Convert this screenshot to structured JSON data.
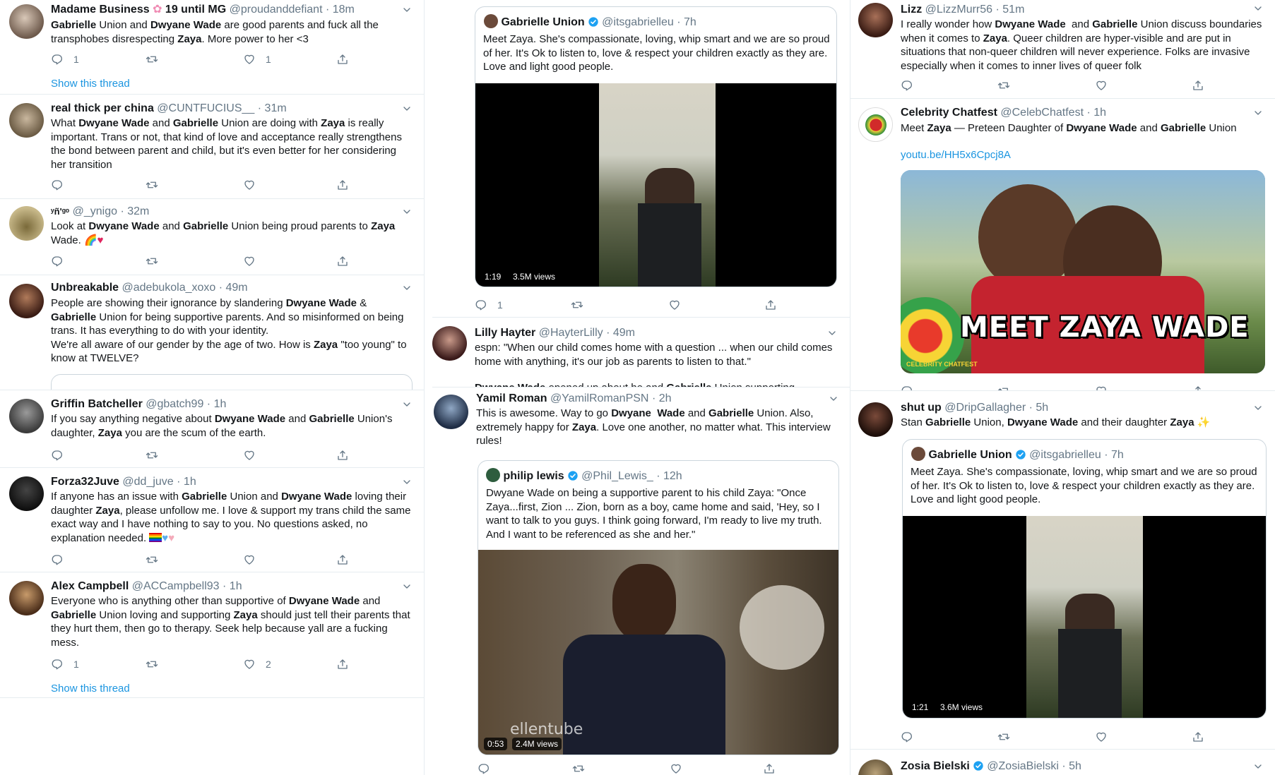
{
  "colors": {
    "accent": "#1b95e0",
    "text": "#14171a",
    "muted": "#657786",
    "divider": "#e6ecf0",
    "heart": "#e0245e"
  },
  "icons": {
    "reply": "reply-icon",
    "retweet": "retweet-icon",
    "like": "heart-icon",
    "share": "share-icon",
    "menu": "chevron-down-icon",
    "verified": "verified-badge-icon"
  },
  "col1": {
    "t1": {
      "name": "Madame Business",
      "name_extra": "19 until MG",
      "handle": "@proudanddefiant",
      "time": "· 18m",
      "replies": "1",
      "likes": "1",
      "show_thread": "Show this thread"
    },
    "t2": {
      "name": "real thick per china",
      "handle": "@CUNTFUCIUS__",
      "time": "· 31m"
    },
    "t3": {
      "name": "ʸñ'ᵍᵒ",
      "handle": "@_ynigo",
      "time": "· 32m"
    },
    "t4": {
      "name": "Unbreakable",
      "handle": "@adebukola_xoxo",
      "time": "· 49m"
    },
    "t5": {
      "name": "Griffin Batcheller",
      "handle": "@gbatch99",
      "time": "· 1h"
    },
    "t6": {
      "name": "Forza32Juve",
      "handle": "@dd_juve",
      "time": "· 1h"
    },
    "t7": {
      "name": "Alex Campbell",
      "handle": "@ACCampbell93",
      "time": "· 1h",
      "replies": "1",
      "likes": "2",
      "show_thread": "Show this thread"
    }
  },
  "col2": {
    "q1": {
      "name": "Gabrielle Union",
      "handle": "@itsgabrielleu",
      "time": "· 7h",
      "text": "Meet Zaya. She's compassionate, loving, whip smart and we are so proud of her. It's Ok to listen to, love & respect your children exactly as they are. Love and light good people.",
      "duration": "1:19",
      "views": "3.5M views",
      "replies": "1"
    },
    "t2": {
      "name": "Lilly Hayter",
      "handle": "@HayterLilly",
      "time": "· 49m",
      "text": "espn: \"When our child comes home with a question ... when our child comes home with anything, it's our job as parents to listen to that.\""
    },
    "t3": {
      "name": "Yamil Roman",
      "handle": "@YamilRomanPSN",
      "time": "· 2h"
    },
    "q3": {
      "name": "philip lewis",
      "handle": "@Phil_Lewis_",
      "time": "· 12h",
      "text": "Dwyane Wade on being a supportive parent to his child Zaya: \"Once Zaya...first, Zion ... Zion, born as a boy, came home and said, 'Hey, so I want to talk to you guys. I think going forward, I'm ready to live my truth. And I want to be referenced as she and her.\"",
      "duration": "0:53",
      "views": "2.4M views"
    }
  },
  "col3": {
    "t1": {
      "name": "Lizz",
      "handle": "@LizzMurr56",
      "time": "· 51m"
    },
    "t2": {
      "name": "Celebrity Chatfest",
      "handle": "@CelebChatfest",
      "time": "· 1h",
      "link": "youtu.be/HH5x6Cpcj8A",
      "banner": "MEET ZAYA WADE",
      "logo_text": "CELEBRITY CHATFEST"
    },
    "t3": {
      "name": "shut up",
      "handle": "@DripGallagher",
      "time": "· 5h"
    },
    "q3": {
      "name": "Gabrielle Union",
      "handle": "@itsgabrielleu",
      "time": "· 7h",
      "text": "Meet Zaya. She's compassionate, loving, whip smart and we are so proud of her. It's Ok to listen to, love & respect your children exactly as they are. Love and light good people.",
      "duration": "1:21",
      "views": "3.6M views"
    },
    "t4": {
      "name": "Zosia Bielski",
      "handle": "@ZosiaBielski",
      "time": "· 5h"
    }
  }
}
